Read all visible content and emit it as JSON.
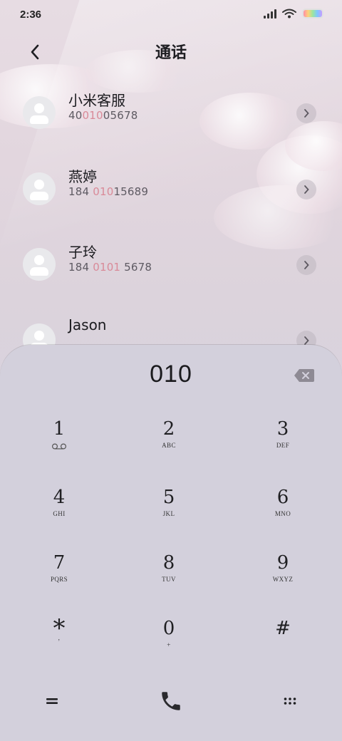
{
  "status_bar": {
    "time": "2:36"
  },
  "header": {
    "title": "通话"
  },
  "contacts": [
    {
      "name": "小米客服",
      "number_pre": "40",
      "number_hl": "010",
      "number_post": "05678"
    },
    {
      "name": "燕婷",
      "number_pre": "184 ",
      "number_hl": "010",
      "number_post": "15689"
    },
    {
      "name": "子玲",
      "number_pre": "184 ",
      "number_hl": "0101",
      "number_post": " 5678"
    },
    {
      "name": "Jason",
      "number_pre": "",
      "number_hl": "",
      "number_post": ""
    }
  ],
  "dialpad": {
    "dialed_number": "010",
    "keys": [
      {
        "digit": "1",
        "letters": ""
      },
      {
        "digit": "2",
        "letters": "ABC"
      },
      {
        "digit": "3",
        "letters": "DEF"
      },
      {
        "digit": "4",
        "letters": "GHI"
      },
      {
        "digit": "5",
        "letters": "JKL"
      },
      {
        "digit": "6",
        "letters": "MNO"
      },
      {
        "digit": "7",
        "letters": "PQRS"
      },
      {
        "digit": "8",
        "letters": "TUV"
      },
      {
        "digit": "9",
        "letters": "WXYZ"
      },
      {
        "digit": "*",
        "letters": ","
      },
      {
        "digit": "0",
        "letters": "+"
      },
      {
        "digit": "#",
        "letters": ""
      }
    ]
  },
  "icons": {
    "back": "chevron-left-icon",
    "contact_detail": "chevron-right-icon",
    "backspace": "backspace-icon",
    "voicemail": "voicemail-icon",
    "collapse": "equals-icon",
    "call": "phone-icon",
    "more": "dots-grid-icon"
  },
  "colors": {
    "highlight": "#d98a98",
    "pad_bg": "#d3d0dc",
    "text": "#1b1b1f"
  }
}
